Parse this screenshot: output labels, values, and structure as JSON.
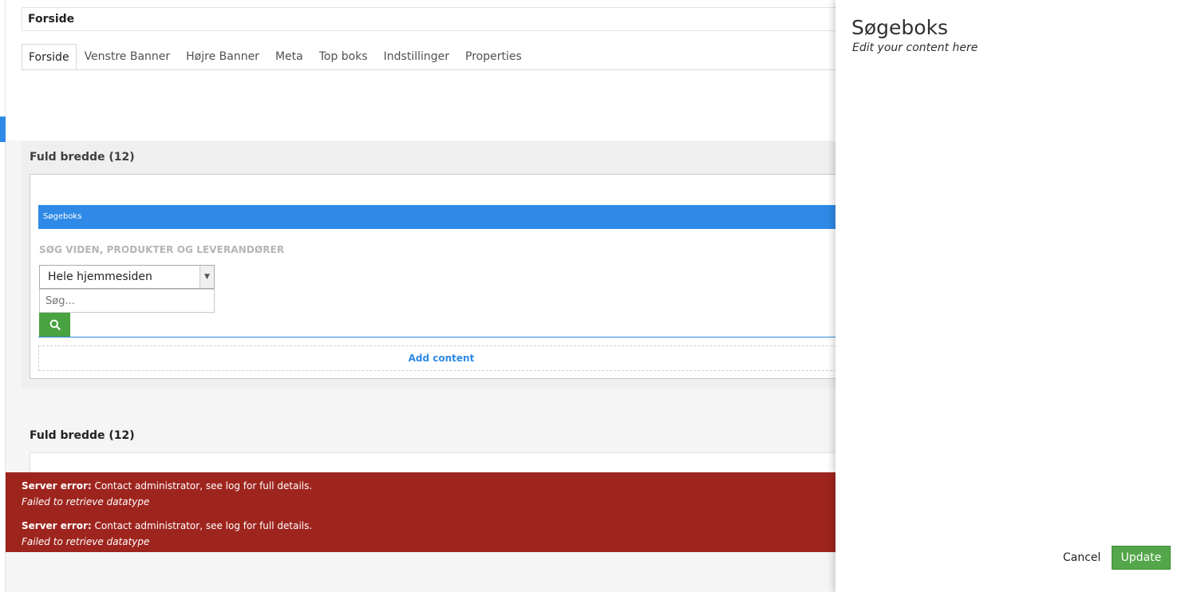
{
  "header": {
    "name_value": "Forside",
    "tabs": [
      {
        "label": "Forside"
      },
      {
        "label": "Venstre Banner"
      },
      {
        "label": "Højre Banner"
      },
      {
        "label": "Meta"
      },
      {
        "label": "Top boks"
      },
      {
        "label": "Indstillinger"
      },
      {
        "label": "Properties"
      }
    ]
  },
  "section1": {
    "title": "Fuld bredde (12)",
    "editor": {
      "bar_label": "Søgeboks",
      "search_heading": "SØG VIDEN, PRODUKTER OG LEVERANDØRER",
      "select_value": "Hele hjemmesiden",
      "search_placeholder": "Søg...",
      "search_icon": "search-icon"
    },
    "add_content": "Add content"
  },
  "section2": {
    "title": "Fuld bredde (12)"
  },
  "errors": [
    {
      "label": "Server error:",
      "message": "Contact administrator, see log for full details.",
      "detail": "Failed to retrieve datatype"
    },
    {
      "label": "Server error:",
      "message": "Contact administrator, see log for full details.",
      "detail": "Failed to retrieve datatype"
    }
  ],
  "dialog": {
    "title": "Søgeboks",
    "subtitle": "Edit your content here",
    "cancel_label": "Cancel",
    "update_label": "Update"
  },
  "colors": {
    "accent": "#2e8ae6",
    "success": "#53a64a",
    "error": "#9e251e"
  }
}
